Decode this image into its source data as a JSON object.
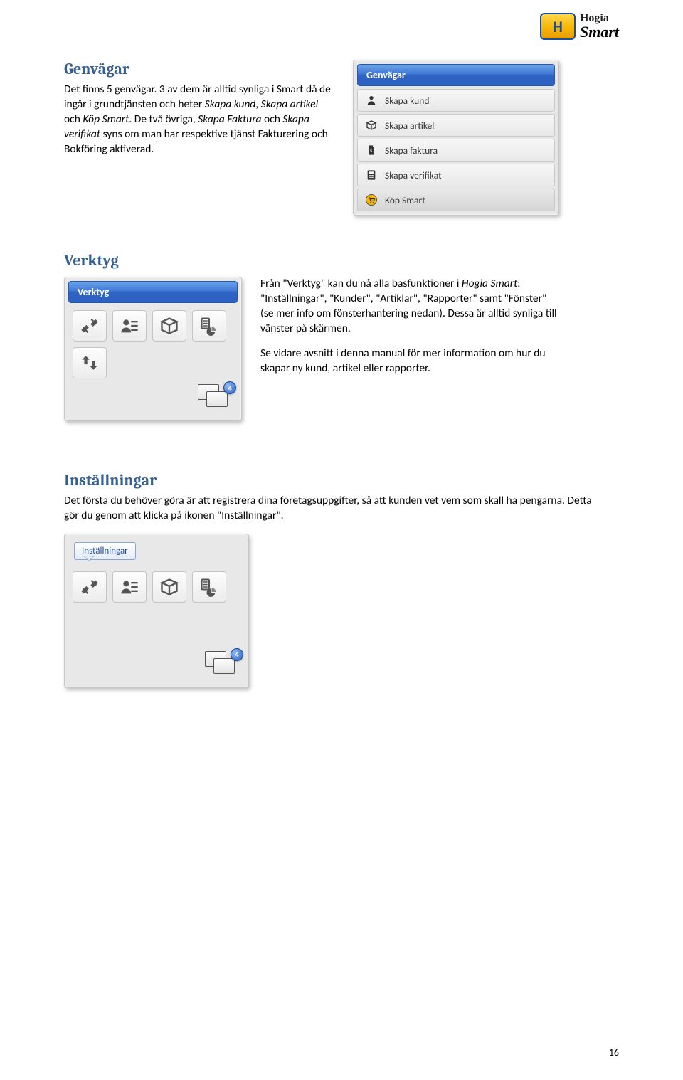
{
  "logo": {
    "brand_top": "Hogia",
    "brand_bottom": "Smart",
    "letter": "H"
  },
  "sections": {
    "genvagar": {
      "heading": "Genvägar",
      "body_html": "Det finns 5 genvägar. 3 av dem är alltid synliga i Smart då de ingår i grundtjänsten och heter <em>Skapa kund</em>, <em>Skapa artikel</em> och <em>Köp Smart</em>. De två övriga, <em>Skapa Faktura</em> och <em>Skapa verifikat</em> syns om man har respektive tjänst Fakturering och Bokföring aktiverad."
    },
    "verktyg": {
      "heading": "Verktyg",
      "body_html": "Från \"Verktyg\" kan du nå alla basfunktioner i <em>Hogia Smart</em>: \"Inställningar\", \"Kunder\", \"Artiklar\", \"Rapporter\" samt \"Fönster\" (se mer info om fönsterhantering nedan). Dessa är alltid synliga till vänster på skärmen.",
      "body2": "Se vidare avsnitt i denna manual för mer information om hur du skapar ny kund, artikel eller rapporter."
    },
    "installningar": {
      "heading": "Inställningar",
      "body": "Det första du behöver göra är att registrera dina företagsuppgifter, så att kunden vet vem som skall ha pengarna. Detta gör du genom att klicka på ikonen \"Inställningar\"."
    }
  },
  "genvagar_panel": {
    "header": "Genvägar",
    "items": [
      {
        "label": "Skapa kund",
        "icon": "user"
      },
      {
        "label": "Skapa artikel",
        "icon": "box"
      },
      {
        "label": "Skapa faktura",
        "icon": "invoice"
      },
      {
        "label": "Skapa verifikat",
        "icon": "calc"
      },
      {
        "label": "Köp Smart",
        "icon": "cart"
      }
    ]
  },
  "verktyg_panel": {
    "header": "Verktyg",
    "tools": [
      "settings",
      "customers",
      "articles",
      "reports",
      "sync"
    ],
    "badge": "4"
  },
  "installningar_panel": {
    "tooltip": "Inställningar",
    "tools": [
      "settings",
      "customers",
      "articles",
      "reports"
    ],
    "badge": "4"
  },
  "page_number": "16"
}
